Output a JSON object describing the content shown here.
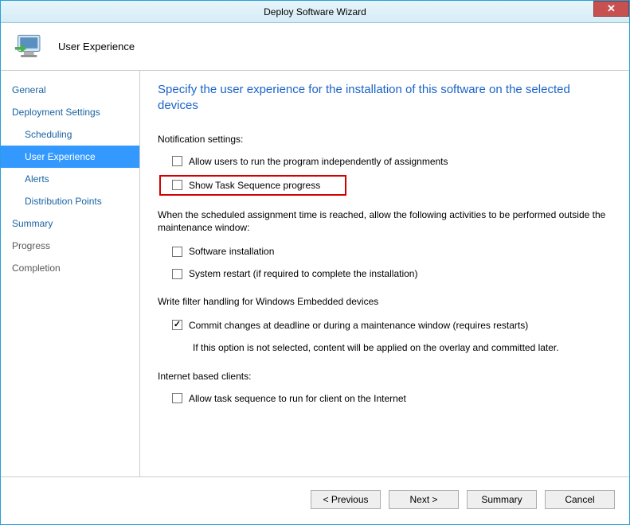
{
  "window": {
    "title": "Deploy Software Wizard"
  },
  "header": {
    "title": "User Experience"
  },
  "sidebar": {
    "items": [
      {
        "label": "General"
      },
      {
        "label": "Deployment Settings"
      },
      {
        "label": "Scheduling"
      },
      {
        "label": "User Experience"
      },
      {
        "label": "Alerts"
      },
      {
        "label": "Distribution Points"
      },
      {
        "label": "Summary"
      },
      {
        "label": "Progress"
      },
      {
        "label": "Completion"
      }
    ]
  },
  "content": {
    "heading": "Specify the user experience for the installation of this software on the selected devices",
    "notification_label": "Notification settings:",
    "allow_users_label": "Allow users to run the program independently of assignments",
    "show_task_label": "Show Task Sequence progress",
    "outside_window_text": "When the scheduled assignment time is reached, allow the following activities to be performed outside the maintenance window:",
    "software_install_label": "Software installation",
    "system_restart_label": "System restart (if required to complete the installation)",
    "write_filter_label": "Write filter handling for Windows Embedded devices",
    "commit_changes_label": "Commit changes at deadline or during a maintenance window (requires restarts)",
    "commit_note": "If this option is not selected, content will be applied on the overlay and committed later.",
    "internet_label": "Internet based clients:",
    "allow_internet_label": "Allow task sequence to run for client on the Internet"
  },
  "footer": {
    "previous": "< Previous",
    "next": "Next >",
    "summary": "Summary",
    "cancel": "Cancel"
  }
}
